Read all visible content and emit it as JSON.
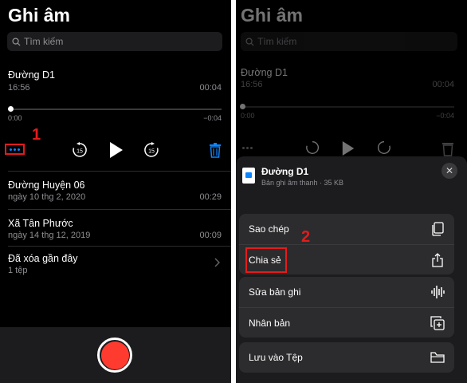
{
  "step_labels": {
    "one": "1",
    "two": "2"
  },
  "colors": {
    "accent": "#0a84ff",
    "record": "#ff3b30",
    "highlight": "#e51b1b",
    "background": "#000000"
  },
  "left": {
    "app_title": "Ghi âm",
    "search_placeholder": "Tìm kiếm",
    "current": {
      "title": "Đường D1",
      "time": "16:56",
      "duration": "00:04",
      "elapsed": "0:00",
      "remaining": "−0:04",
      "skip_back": "15",
      "skip_forward": "15"
    },
    "recordings": [
      {
        "title": "Đường Huyện 06",
        "date": "ngày 10 thg 2, 2020",
        "duration": "00:29"
      },
      {
        "title": "Xã Tân Phước",
        "date": "ngày 14 thg 12, 2019",
        "duration": "00:09"
      }
    ],
    "deleted": {
      "title": "Đã xóa gần đây",
      "count": "1 tệp"
    }
  },
  "right": {
    "app_title": "Ghi âm",
    "search_placeholder": "Tìm kiếm",
    "current": {
      "title": "Đường D1",
      "time": "16:56",
      "duration": "00:04",
      "elapsed": "0:00",
      "remaining": "−0:04"
    },
    "sheet": {
      "title": "Đường D1",
      "subtitle": "Bản ghi âm thanh · 35 KB",
      "groups": [
        [
          {
            "label": "Sao chép",
            "icon": "copy-icon"
          },
          {
            "label": "Chia sẻ",
            "icon": "share-icon"
          }
        ],
        [
          {
            "label": "Sửa bản ghi",
            "icon": "waveform-icon"
          },
          {
            "label": "Nhân bản",
            "icon": "duplicate-icon"
          }
        ],
        [
          {
            "label": "Lưu vào Tệp",
            "icon": "folder-icon"
          }
        ]
      ]
    }
  }
}
